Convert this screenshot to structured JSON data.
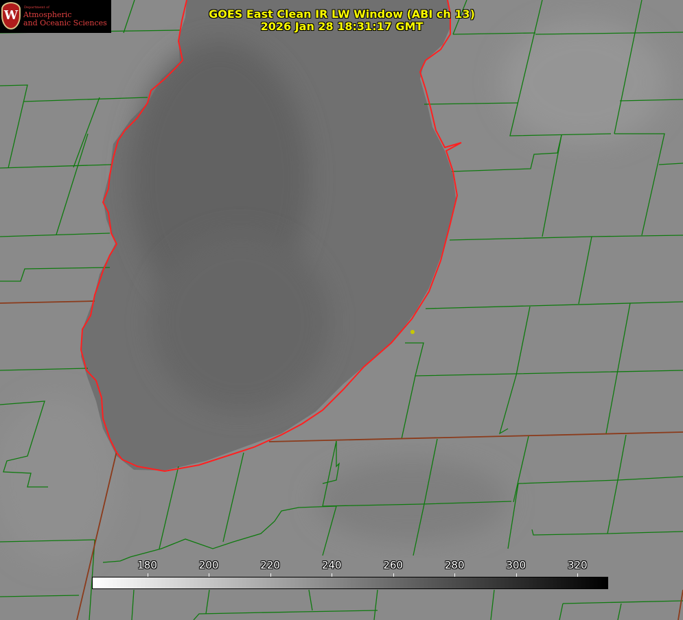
{
  "title": {
    "line1": "GOES East Clean IR LW Window (ABI ch 13)",
    "line2": "2026 Jan 28 18:31:17 GMT"
  },
  "logo": {
    "department": "Department of",
    "line1": "Atmospheric",
    "line2": "and Oceanic Sciences",
    "seal_letter": "W"
  },
  "colorbar": {
    "ticks": [
      "180",
      "200",
      "220",
      "240",
      "260",
      "280",
      "300",
      "320"
    ],
    "range_values": [
      162,
      330
    ],
    "tick_values": [
      180,
      200,
      220,
      240,
      260,
      280,
      300,
      320
    ]
  },
  "map": {
    "land_color": "#8a8a8a",
    "lake_color": "#6a6a6a",
    "county_line_color": "#0e7a0e",
    "state_line_color": "#8b3a1a",
    "coastline_color": "#ff2020",
    "marker_color": "#c8c800"
  }
}
